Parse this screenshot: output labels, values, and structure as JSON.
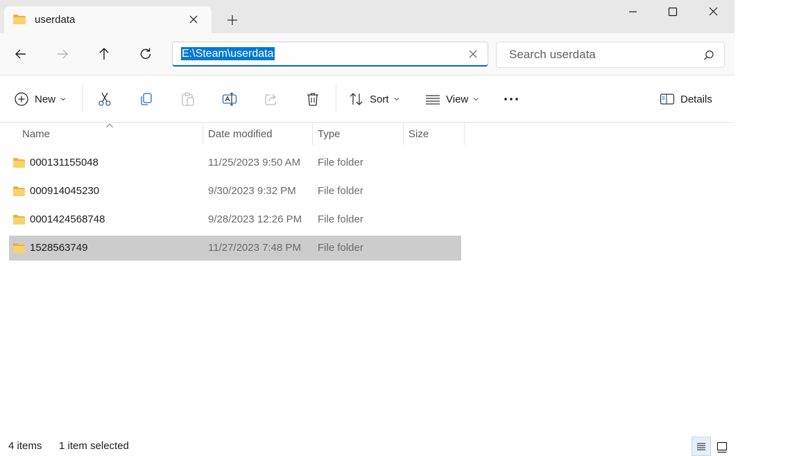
{
  "window": {
    "tab_title": "userdata",
    "folder_color": "#f4c542"
  },
  "nav": {
    "address": "E:\\Steam\\userdata",
    "search_placeholder": "Search userdata",
    "icons": [
      "back-arrow-icon",
      "forward-arrow-icon",
      "up-arrow-icon",
      "refresh-icon"
    ]
  },
  "toolbar": {
    "new_label": "New",
    "sort_label": "Sort",
    "view_label": "View",
    "details_label": "Details",
    "icons": [
      "cut-icon",
      "copy-icon",
      "paste-icon",
      "rename-icon",
      "share-icon",
      "delete-icon",
      "more-icon"
    ]
  },
  "columns": {
    "name": "Name",
    "date": "Date modified",
    "type": "Type",
    "size": "Size"
  },
  "files": [
    {
      "name": "000131155048",
      "date": "11/25/2023 9:50 AM",
      "type": "File folder",
      "selected": false
    },
    {
      "name": "000914045230",
      "date": "9/30/2023 9:32 PM",
      "type": "File folder",
      "selected": false
    },
    {
      "name": "0001424568748",
      "date": "9/28/2023 12:26 PM",
      "type": "File folder",
      "selected": false
    },
    {
      "name": "1528563749",
      "date": "11/27/2023 7:48 PM",
      "type": "File folder",
      "selected": true
    }
  ],
  "status": {
    "items": "4 items",
    "selected": "1 item selected"
  },
  "colors": {
    "accent": "#0078d4",
    "selection": "#cccccc"
  }
}
